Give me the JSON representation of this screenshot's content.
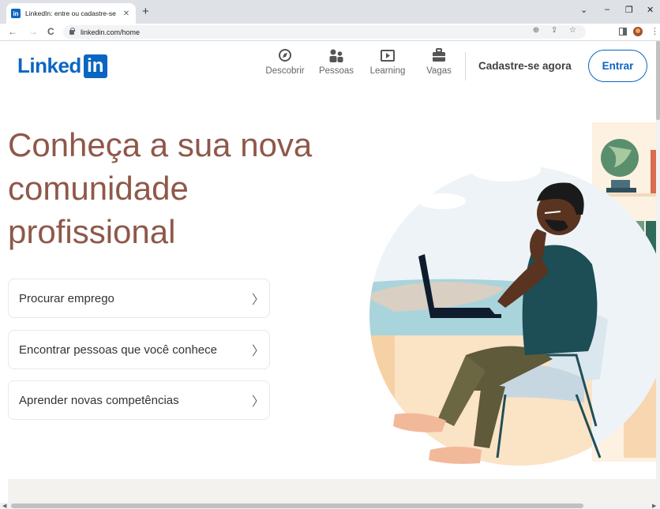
{
  "browser": {
    "tab_title": "LinkedIn: entre ou cadastre-se",
    "tab_close": "✕",
    "new_tab": "+",
    "url": "linkedin.com/home",
    "controls": {
      "collapse": "⌄",
      "minimize": "–",
      "restore": "❐",
      "close": "✕"
    },
    "nav": {
      "back": "←",
      "forward": "→",
      "reload": "C"
    },
    "url_icons": "⊕ ⇪ ☆",
    "menu": "⋮"
  },
  "header": {
    "logo_text": "Linked",
    "logo_box": "in",
    "nav": [
      {
        "label": "Descobrir",
        "icon": "compass-icon"
      },
      {
        "label": "Pessoas",
        "icon": "people-icon"
      },
      {
        "label": "Learning",
        "icon": "video-icon"
      },
      {
        "label": "Vagas",
        "icon": "briefcase-icon"
      }
    ],
    "join_label": "Cadastre-se agora",
    "signin_label": "Entrar"
  },
  "hero": {
    "title": "Conheça a sua nova comunidade profissional",
    "actions": [
      {
        "label": "Procurar emprego"
      },
      {
        "label": "Encontrar pessoas que você conhece"
      },
      {
        "label": "Aprender novas competências"
      }
    ],
    "chevron": "〉"
  },
  "colors": {
    "brand": "#0a66c2",
    "hero_title": "#8f5849",
    "tab_bar": "#dee1e6"
  }
}
